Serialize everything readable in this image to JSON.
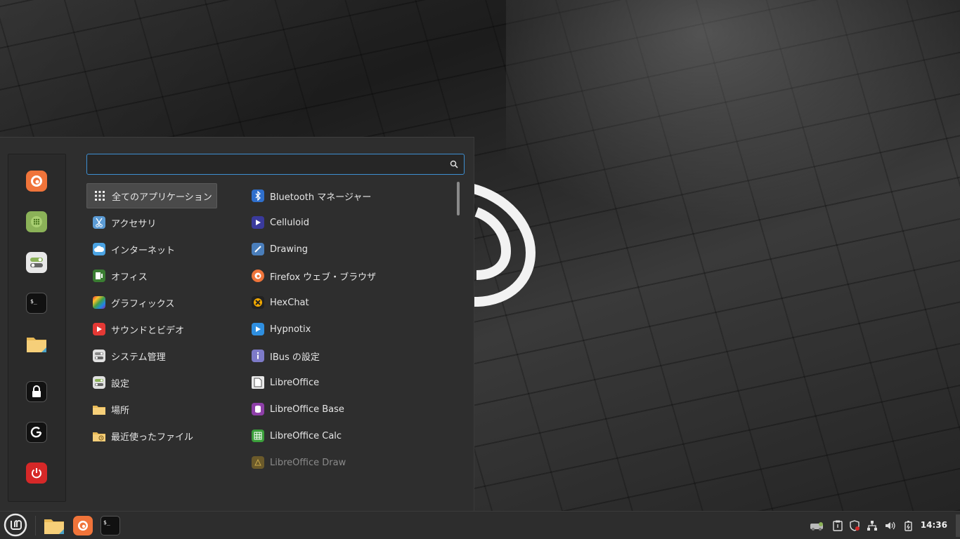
{
  "search": {
    "value": "",
    "placeholder": ""
  },
  "categories": [
    {
      "label": "全てのアプリケーション",
      "icon": "grid-icon"
    },
    {
      "label": "アクセサリ",
      "icon": "scissors-icon"
    },
    {
      "label": "インターネット",
      "icon": "cloud-icon"
    },
    {
      "label": "オフィス",
      "icon": "office-icon"
    },
    {
      "label": "グラフィックス",
      "icon": "graphics-icon"
    },
    {
      "label": "サウンドとビデオ",
      "icon": "play-icon"
    },
    {
      "label": "システム管理",
      "icon": "toggles-icon"
    },
    {
      "label": "設定",
      "icon": "settings-icon"
    },
    {
      "label": "場所",
      "icon": "folder-icon"
    },
    {
      "label": "最近使ったファイル",
      "icon": "recent-folder-icon"
    }
  ],
  "apps": [
    {
      "label": "Bluetooth マネージャー",
      "icon": "bluetooth-icon"
    },
    {
      "label": "Celluloid",
      "icon": "celluloid-icon"
    },
    {
      "label": "Drawing",
      "icon": "drawing-icon"
    },
    {
      "label": "Firefox ウェブ・ブラウザ",
      "icon": "firefox-icon"
    },
    {
      "label": "HexChat",
      "icon": "hexchat-icon"
    },
    {
      "label": "Hypnotix",
      "icon": "hypnotix-icon"
    },
    {
      "label": "IBus の設定",
      "icon": "ibus-icon"
    },
    {
      "label": "LibreOffice",
      "icon": "libreoffice-icon"
    },
    {
      "label": "LibreOffice Base",
      "icon": "libreoffice-base-icon"
    },
    {
      "label": "LibreOffice Calc",
      "icon": "libreoffice-calc-icon"
    },
    {
      "label": "LibreOffice Draw",
      "icon": "libreoffice-draw-icon"
    }
  ],
  "favorites": [
    {
      "name": "firefox",
      "icon": "firefox-icon"
    },
    {
      "name": "software-manager",
      "icon": "software-manager-icon"
    },
    {
      "name": "system-settings",
      "icon": "toggles-icon"
    },
    {
      "name": "terminal",
      "icon": "terminal-icon"
    },
    {
      "name": "files",
      "icon": "folder-icon"
    }
  ],
  "session": [
    {
      "name": "lock-screen",
      "icon": "lock-icon"
    },
    {
      "name": "logout",
      "icon": "logout-icon"
    },
    {
      "name": "shutdown",
      "icon": "power-icon"
    }
  ],
  "panel": {
    "clock": "14:36",
    "launchers": [
      "folder-icon",
      "firefox-icon",
      "terminal-icon"
    ],
    "tray": [
      "update-manager-icon",
      "clipboard-icon",
      "shield-icon",
      "network-icon",
      "volume-icon",
      "battery-icon"
    ]
  },
  "colors": {
    "accent": "#3d8fd1",
    "firefox": "#f0743a",
    "power": "#d62828",
    "mint": "#8bb258"
  }
}
